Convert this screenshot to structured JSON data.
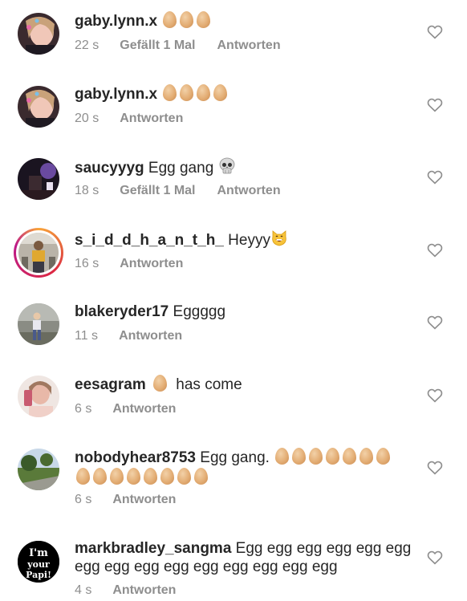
{
  "comments": [
    {
      "username": "gaby.lynn.x",
      "text": "",
      "eggs": 3,
      "time": "22 s",
      "likes": "Gefällt 1 Mal",
      "reply": "Antworten"
    },
    {
      "username": "gaby.lynn.x",
      "text": "",
      "eggs": 4,
      "time": "20 s",
      "likes": "",
      "reply": "Antworten"
    },
    {
      "username": "saucyyyg",
      "text": "Egg gang",
      "icon": "skull-emoji",
      "time": "18 s",
      "likes": "Gefällt 1 Mal",
      "reply": "Antworten"
    },
    {
      "username": "s_i_d_d_h_a_n_t_h_",
      "text": "Heyyy",
      "icon": "grinning-cat-emoji",
      "time": "16 s",
      "likes": "",
      "reply": "Antworten"
    },
    {
      "username": "blakeryder17",
      "text": "Eggggg",
      "time": "11 s",
      "likes": "",
      "reply": "Antworten"
    },
    {
      "username": "eesagram",
      "text": "has come",
      "eggs_before_text": 1,
      "time": "6 s",
      "likes": "",
      "reply": "Antworten"
    },
    {
      "username": "nobodyhear8753",
      "text": "Egg gang.",
      "eggs": 7,
      "eggs_line2": 8,
      "time": "6 s",
      "likes": "",
      "reply": "Antworten"
    },
    {
      "username": "markbradley_sangma",
      "text": "Egg egg egg egg egg egg egg egg egg egg egg egg egg egg egg",
      "avatar_text": [
        "I'm",
        "your",
        "Papi!"
      ],
      "time": "4 s",
      "likes": "",
      "reply": "Antworten"
    }
  ],
  "colors": {
    "text": "#262626",
    "meta": "#8e8e8e",
    "heart": "#8e8e8e"
  }
}
